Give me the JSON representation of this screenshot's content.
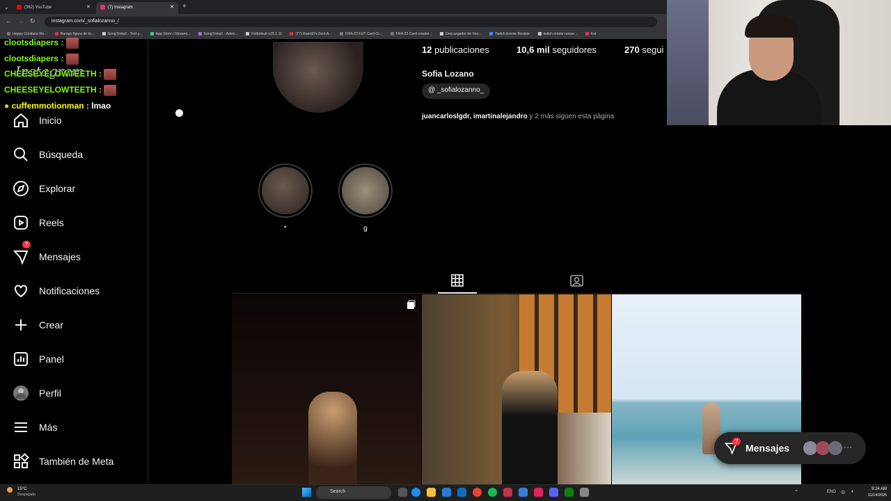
{
  "browser": {
    "tabs": [
      {
        "label": "(362) YouTube",
        "active": false,
        "color": "#ff0000"
      },
      {
        "label": "(7) Instagram",
        "active": true,
        "color": "#e1306c"
      }
    ],
    "url": "instagram.com/_sofialozanno_/",
    "bookmarks": [
      "Happy Cristiano Ro...",
      "Burago figura de to...",
      "SongTrivia2 - Test y...",
      "App Store / Streami...",
      "SongTrivia2 - Advin...",
      "Futbolsub v25.1.11",
      "(77) Razo97s Zest-A...",
      "FIFA 23 FUT Card Cr...",
      "FIFA 23 Card creator...",
      "Descargador de You...",
      "Twitch Emote Resizer",
      "twitch emote resize...",
      "Est"
    ]
  },
  "chat": [
    {
      "user": "clootsdiapers",
      "msg": ""
    },
    {
      "user": "clootsdiapers",
      "msg": ""
    },
    {
      "user": "CHEESEYELOWTEETH",
      "msg": ""
    },
    {
      "user": "CHEESEYELOWTEETH",
      "msg": ""
    },
    {
      "user": "cuffemmotionman",
      "msg": "lmao"
    }
  ],
  "sidebar": {
    "items": [
      {
        "label": "Inicio",
        "icon": "home-icon"
      },
      {
        "label": "Búsqueda",
        "icon": "search-icon"
      },
      {
        "label": "Explorar",
        "icon": "compass-icon"
      },
      {
        "label": "Reels",
        "icon": "reels-icon"
      },
      {
        "label": "Mensajes",
        "icon": "messenger-icon",
        "badge": "7"
      },
      {
        "label": "Notificaciones",
        "icon": "heart-icon"
      },
      {
        "label": "Crear",
        "icon": "plus-icon"
      },
      {
        "label": "Panel",
        "icon": "dashboard-icon"
      },
      {
        "label": "Perfil",
        "icon": "avatar"
      },
      {
        "label": "Más",
        "icon": "menu-icon"
      },
      {
        "label": "También de Meta",
        "icon": "meta-icon"
      }
    ]
  },
  "profile": {
    "posts_count": "12",
    "posts_label": "publicaciones",
    "followers_count": "10,6 mil",
    "followers_label": "seguidores",
    "following_count": "270",
    "following_label": "segui",
    "name": "Sofia Lozano",
    "threads_handle": "_sofialozanno_",
    "followed_by_users": "juancarloslgdr, imartinalejandro",
    "followed_by_rest": "y 2 más siguen esta página"
  },
  "highlights": [
    {
      "label": "*"
    },
    {
      "label": "g"
    }
  ],
  "messages_pill": {
    "label": "Mensajes",
    "badge": "7"
  },
  "taskbar": {
    "weather_temp": "15°C",
    "weather_desc": "Despejado",
    "search_label": "Search",
    "lang": "ENG",
    "time": "9:24 AM",
    "date": "11/14/2025"
  },
  "colors": {
    "accent_badge": "#ff3040",
    "chat_name": "#7CFC00",
    "bg": "#000000"
  }
}
